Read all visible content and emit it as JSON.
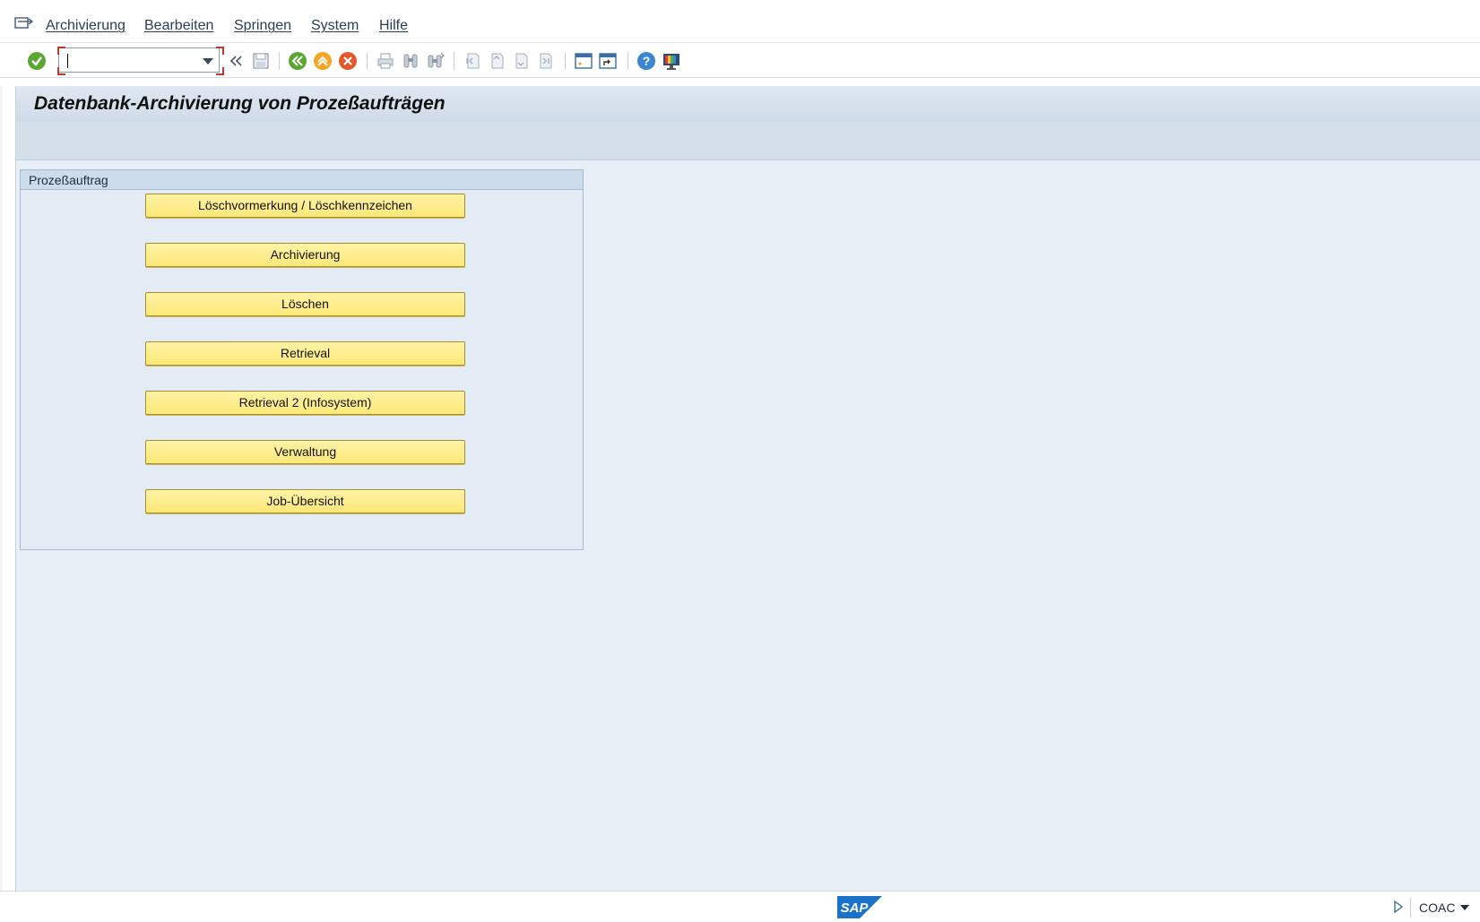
{
  "menubar": {
    "items": [
      {
        "label": "Archivierung"
      },
      {
        "label": "Bearbeiten"
      },
      {
        "label": "Springen"
      },
      {
        "label": "System"
      },
      {
        "label": "Hilfe"
      }
    ]
  },
  "toolbar": {
    "command_field": {
      "value": "",
      "placeholder": ""
    },
    "icons": [
      "enter-check-icon",
      "collapse-arrows-icon",
      "save-icon",
      "back-icon",
      "exit-icon",
      "cancel-icon",
      "print-icon",
      "find-icon",
      "find-next-icon",
      "first-page-icon",
      "previous-page-icon",
      "next-page-icon",
      "last-page-icon",
      "create-session-icon",
      "shortcut-icon",
      "help-icon",
      "customize-layout-icon"
    ]
  },
  "screen": {
    "title": "Datenbank-Archivierung von Prozeßaufträgen"
  },
  "groupbox": {
    "title": "Prozeßauftrag",
    "buttons": [
      {
        "label": "Löschvormerkung / Löschkennzeichen"
      },
      {
        "label": "Archivierung"
      },
      {
        "label": "Löschen"
      },
      {
        "label": "Retrieval"
      },
      {
        "label": "Retrieval 2 (Infosystem)"
      },
      {
        "label": "Verwaltung"
      },
      {
        "label": "Job-Übersicht"
      }
    ]
  },
  "statusbar": {
    "logo": "SAP",
    "system": "COAC"
  },
  "colors": {
    "button_yellow": "#fde878",
    "background": "#e7eff7",
    "sap_blue": "#1a73c9"
  }
}
